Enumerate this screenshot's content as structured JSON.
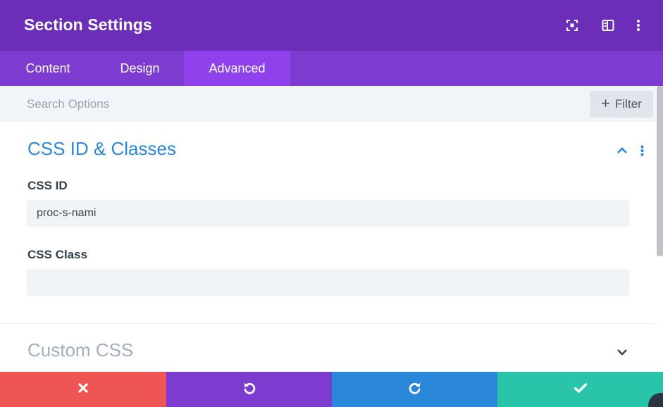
{
  "header": {
    "title": "Section Settings",
    "icons": [
      "fullscreen-icon",
      "sidebar-layout-icon",
      "more-options-icon"
    ]
  },
  "tabs": [
    {
      "label": "Content",
      "active": false
    },
    {
      "label": "Design",
      "active": false
    },
    {
      "label": "Advanced",
      "active": true
    }
  ],
  "search": {
    "placeholder": "Search Options",
    "value": "",
    "filter_label": "Filter"
  },
  "groups": {
    "css_id_classes": {
      "title": "CSS ID & Classes",
      "state": "expanded",
      "fields": {
        "css_id": {
          "label": "CSS ID",
          "value": "proc-s-nami"
        },
        "css_class": {
          "label": "CSS Class",
          "value": ""
        }
      }
    },
    "custom_css": {
      "title": "Custom CSS",
      "state": "collapsed"
    }
  },
  "footer": {
    "buttons": [
      {
        "name": "discard",
        "icon": "close-icon",
        "color": "#ef5555"
      },
      {
        "name": "undo",
        "icon": "undo-icon",
        "color": "#7e3bd0"
      },
      {
        "name": "redo",
        "icon": "redo-icon",
        "color": "#2b87da"
      },
      {
        "name": "save",
        "icon": "check-icon",
        "color": "#29c4a9"
      }
    ]
  },
  "colors": {
    "header": "#6c2eb9",
    "tabs": "#7e3bd0",
    "active_tab": "#8f42ec",
    "accent_blue": "#2b87da"
  }
}
